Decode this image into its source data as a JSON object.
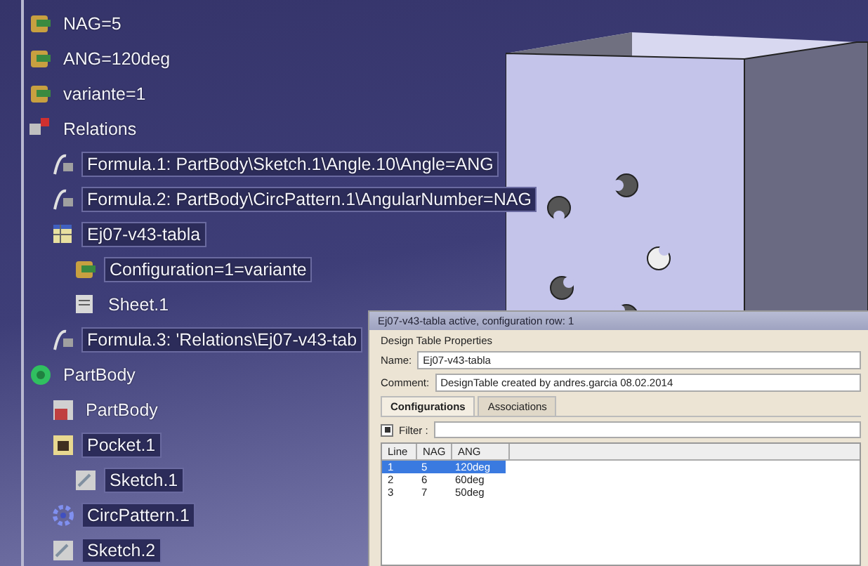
{
  "tree": [
    {
      "label": "NAG=5",
      "kind": "parameter",
      "highlighted": false
    },
    {
      "label": "ANG=120deg",
      "kind": "parameter",
      "highlighted": false
    },
    {
      "label": "variante=1",
      "kind": "parameter",
      "highlighted": false
    },
    {
      "label": "Relations",
      "kind": "relations",
      "highlighted": false,
      "children": [
        {
          "label": "Formula.1: PartBody\\Sketch.1\\Angle.10\\Angle=ANG",
          "kind": "formula",
          "highlighted": true
        },
        {
          "label": "Formula.2: PartBody\\CircPattern.1\\AngularNumber=NAG",
          "kind": "formula",
          "highlighted": true
        },
        {
          "label": "Ej07-v43-tabla",
          "kind": "table",
          "highlighted": true,
          "children": [
            {
              "label": "Configuration=1=variante",
              "kind": "parameter",
              "highlighted": true
            },
            {
              "label": "Sheet.1",
              "kind": "sheet",
              "highlighted": false
            }
          ]
        },
        {
          "label": "Formula.3: 'Relations\\Ej07-v43-tab",
          "kind": "formula",
          "highlighted": true
        }
      ]
    },
    {
      "label": "PartBody",
      "kind": "body",
      "highlighted": false,
      "children": [
        {
          "label": "PartBody",
          "kind": "partbody",
          "highlighted": false
        },
        {
          "label": "Pocket.1",
          "kind": "pocket",
          "highlighted": true,
          "children": [
            {
              "label": "Sketch.1",
              "kind": "sketch",
              "highlighted": true
            }
          ]
        },
        {
          "label": "CircPattern.1",
          "kind": "pattern",
          "highlighted": true
        },
        {
          "label": "Sketch.2",
          "kind": "sketch",
          "highlighted": true
        }
      ]
    }
  ],
  "dialog": {
    "title": "Ej07-v43-tabla active, configuration row: 1",
    "section": "Design Table Properties",
    "name_label": "Name:",
    "name_value": "Ej07-v43-tabla",
    "comment_label": "Comment:",
    "comment_value": "DesignTable created by andres.garcia 08.02.2014",
    "tabs": [
      {
        "label": "Configurations",
        "selected": true
      },
      {
        "label": "Associations",
        "selected": false
      }
    ],
    "filter": {
      "label": "Filter :",
      "checked": true
    },
    "table": {
      "columns": [
        "Line",
        "NAG",
        "ANG"
      ],
      "rows": [
        {
          "cells": [
            "1",
            "5",
            "120deg"
          ],
          "selected": true
        },
        {
          "cells": [
            "2",
            "6",
            "60deg"
          ],
          "selected": false
        },
        {
          "cells": [
            "3",
            "7",
            "50deg"
          ],
          "selected": false
        }
      ]
    }
  }
}
